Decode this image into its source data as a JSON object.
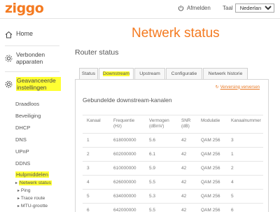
{
  "header": {
    "logo": "ziggo",
    "logout_label": "Afmelden",
    "language_label": "Taal",
    "language_selected": "Nederlands"
  },
  "sidebar": {
    "home": "Home",
    "connected_devices": "Verbonden apparaten",
    "advanced_settings": "Geavanceerde instellingen",
    "sub_items": [
      "Draadloos",
      "Beveiliging",
      "DHCP",
      "DNS",
      "UPnP",
      "DDNS",
      "Hulpmiddelen"
    ],
    "tools_sub_items": [
      "Netwerk status",
      "Ping",
      "Trace route",
      "MTU-grootte"
    ]
  },
  "main": {
    "page_title": "Netwerk status",
    "section_title": "Router status",
    "tabs": [
      "Status",
      "Downstream",
      "Upstream",
      "Configuratie",
      "Netwerk historie"
    ],
    "refresh_label": "Verversing verversen",
    "panel_title": "Gebundelde downstream-kanalen",
    "table": {
      "headers": [
        "Kanaal",
        "Frequentie (Hz)",
        "Vermogen (dBmV)",
        "SNR (dB)",
        "Modulatie",
        "Kanaalnummer"
      ],
      "rows": [
        [
          "1",
          "618000000",
          "5.6",
          "42",
          "QAM 256",
          "3"
        ],
        [
          "2",
          "602000000",
          "6.1",
          "42",
          "QAM 256",
          "1"
        ],
        [
          "3",
          "610000000",
          "5.9",
          "42",
          "QAM 256",
          "2"
        ],
        [
          "4",
          "626000000",
          "5.5",
          "42",
          "QAM 256",
          "4"
        ],
        [
          "5",
          "634000000",
          "5.3",
          "42",
          "QAM 256",
          "5"
        ],
        [
          "6",
          "642000000",
          "5.5",
          "42",
          "QAM 256",
          "6"
        ]
      ]
    }
  },
  "colors": {
    "brand": "#f47a20",
    "highlight": "#ffff33"
  },
  "icons": [
    "power-icon",
    "home-icon",
    "devices-icon",
    "gear-icon",
    "chevron-right-icon",
    "refresh-icon"
  ]
}
